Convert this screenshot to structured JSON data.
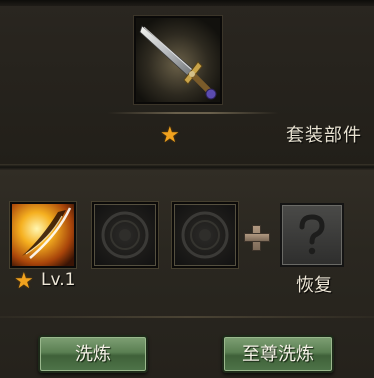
{
  "equipment": {
    "item_icon": "sword-icon",
    "star": "★",
    "set_label": "套装部件"
  },
  "refine": {
    "skill_icon": "slash-skill-icon",
    "star": "★",
    "level_text": "Lv.1",
    "empty_slot_icon": "empty-slot-emblem-icon",
    "plus_icon": "plus-icon",
    "unknown_icon": "question-mark-icon",
    "restore_label": "恢复"
  },
  "buttons": {
    "refine_label": "洗炼",
    "supreme_refine_label": "至尊洗炼"
  },
  "colors": {
    "star": "#f1a21e",
    "button_green": "#5a7f52",
    "text": "#ede6d6"
  }
}
